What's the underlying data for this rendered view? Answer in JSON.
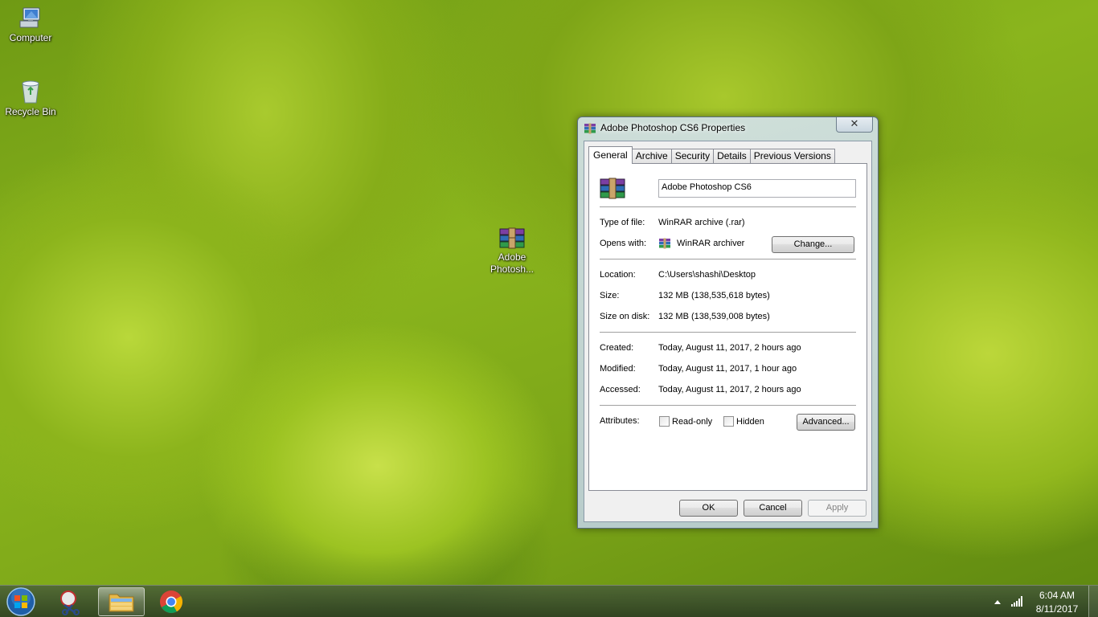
{
  "desktop": {
    "icons": [
      {
        "label": "Computer",
        "icon": "computer-icon"
      },
      {
        "label": "Recycle Bin",
        "icon": "recycle-bin-icon"
      },
      {
        "label_line1": "Adobe",
        "label_line2": "Photosh...",
        "icon": "winrar-archive-icon"
      }
    ]
  },
  "dialog": {
    "title": "Adobe Photoshop CS6 Properties",
    "close_label": "✕",
    "tabs": [
      {
        "label": "General",
        "active": true
      },
      {
        "label": "Archive"
      },
      {
        "label": "Security"
      },
      {
        "label": "Details"
      },
      {
        "label": "Previous Versions"
      }
    ],
    "general": {
      "file_name": "Adobe Photoshop CS6",
      "type_label": "Type of file:",
      "type_value": "WinRAR archive (.rar)",
      "opens_label": "Opens with:",
      "opens_value": "WinRAR archiver",
      "change_button": "Change...",
      "location_label": "Location:",
      "location_value": "C:\\Users\\shashi\\Desktop",
      "size_label": "Size:",
      "size_value": "132 MB (138,535,618 bytes)",
      "size_on_disk_label": "Size on disk:",
      "size_on_disk_value": "132 MB (138,539,008 bytes)",
      "created_label": "Created:",
      "created_value": "Today, August 11, 2017, 2 hours ago",
      "modified_label": "Modified:",
      "modified_value": "Today, August 11, 2017, 1 hour ago",
      "accessed_label": "Accessed:",
      "accessed_value": "Today, August 11, 2017, 2 hours ago",
      "attributes_label": "Attributes:",
      "readonly_label": "Read-only",
      "readonly_checked": false,
      "hidden_label": "Hidden",
      "hidden_checked": false,
      "advanced_button": "Advanced..."
    },
    "buttons": {
      "ok": "OK",
      "cancel": "Cancel",
      "apply": "Apply"
    }
  },
  "taskbar": {
    "pinned": [
      {
        "icon": "snipping-tool-icon"
      },
      {
        "icon": "file-explorer-icon",
        "active": true
      },
      {
        "icon": "chrome-icon"
      }
    ],
    "clock_time": "6:04 AM",
    "clock_date": "8/11/2017"
  },
  "colors": {
    "accent_title": "#000000",
    "taskbar": "#3a4a30",
    "wallpaper_green": "#9cc322"
  }
}
